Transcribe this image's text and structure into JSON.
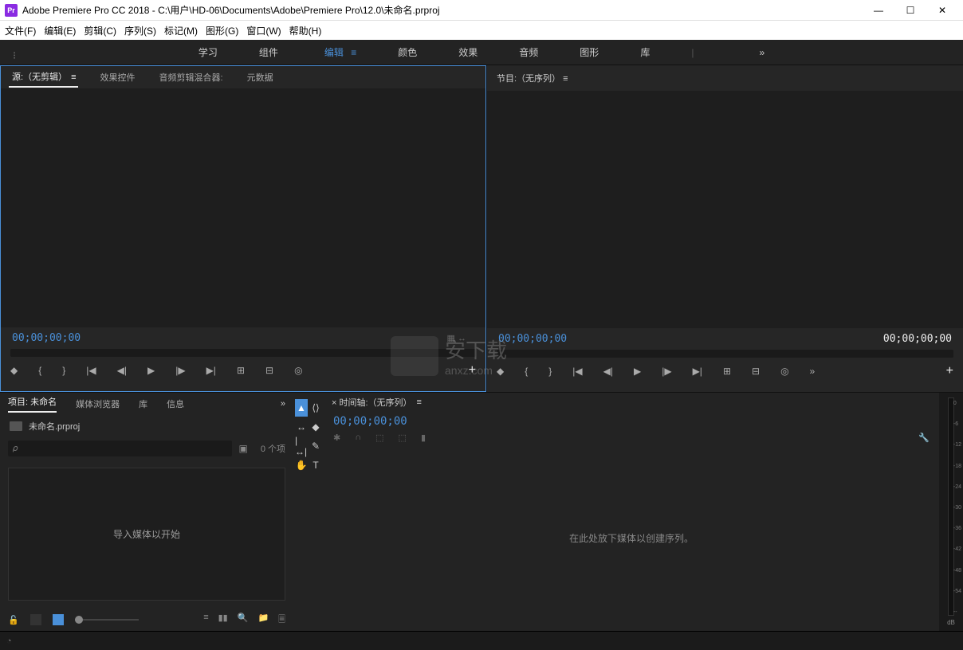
{
  "titlebar": {
    "icon_text": "Pr",
    "title": "Adobe Premiere Pro CC 2018 - C:\\用户\\HD-06\\Documents\\Adobe\\Premiere Pro\\12.0\\未命名.prproj"
  },
  "menubar": [
    "文件(F)",
    "编辑(E)",
    "剪辑(C)",
    "序列(S)",
    "标记(M)",
    "图形(G)",
    "窗口(W)",
    "帮助(H)"
  ],
  "workspaces": {
    "items": [
      "学习",
      "组件",
      "编辑",
      "颜色",
      "效果",
      "音频",
      "图形",
      "库"
    ],
    "active_index": 2,
    "overflow": "»"
  },
  "source_panel": {
    "tabs": [
      "源:（无剪辑）",
      "效果控件",
      "音频剪辑混合器:",
      "元数据"
    ],
    "active_index": 0,
    "timecode_left": "00;00;00;00",
    "fit_label": "▦   ↔"
  },
  "program_panel": {
    "tab": "节目:（无序列）",
    "timecode_left": "00;00;00;00",
    "timecode_right": "00;00;00;00"
  },
  "transport_icons": [
    "◆",
    "{",
    "}",
    "|◀",
    "◀|",
    "▶",
    "|▶",
    "▶|",
    "⊞",
    "⊟",
    "◎"
  ],
  "project_panel": {
    "tabs": [
      "项目: 未命名",
      "媒体浏览器",
      "库",
      "信息"
    ],
    "active_index": 0,
    "overflow": "»",
    "filename": "未命名.prproj",
    "search_placeholder": "𝜌",
    "item_count": "0 个项",
    "drop_hint": "导入媒体以开始"
  },
  "tools": [
    {
      "glyph": "▲",
      "name": "selection-tool",
      "active": true
    },
    {
      "glyph": "⟨⟩",
      "name": "track-select-tool"
    },
    {
      "glyph": "↔",
      "name": "ripple-tool"
    },
    {
      "glyph": "◆",
      "name": "rolling-tool"
    },
    {
      "glyph": "|↔|",
      "name": "rate-tool"
    },
    {
      "glyph": "✎",
      "name": "pen-tool"
    },
    {
      "glyph": "✋",
      "name": "hand-tool"
    },
    {
      "glyph": "T",
      "name": "type-tool"
    }
  ],
  "timeline": {
    "tab": "× 时间轴:（无序列）",
    "timecode": "00;00;00;00",
    "icons": [
      "✱",
      "∩",
      "⬚",
      "⬚",
      "▮",
      "🔧"
    ],
    "drop_hint": "在此处放下媒体以创建序列。"
  },
  "audio_meter": {
    "scale": [
      "0",
      "-6",
      "-12",
      "-18",
      "-24",
      "-30",
      "-36",
      "-42",
      "-48",
      "-54",
      "--"
    ],
    "db_label": "dB"
  },
  "watermark": {
    "text1": "安下载",
    "text2": "anxz.com"
  }
}
